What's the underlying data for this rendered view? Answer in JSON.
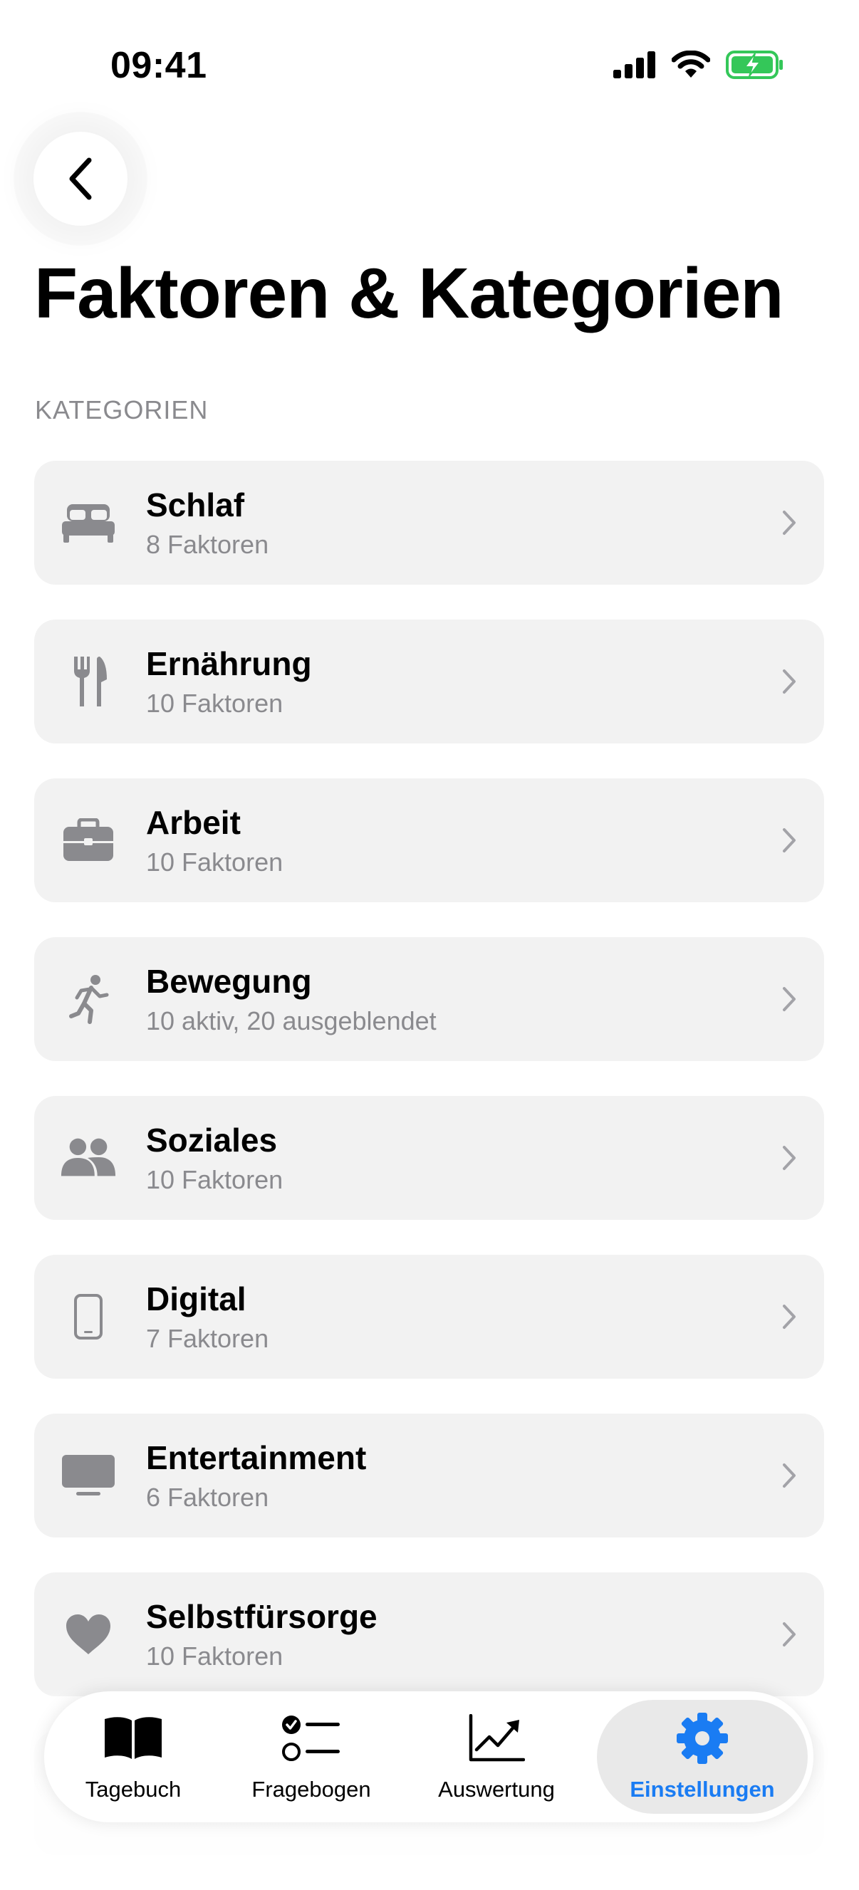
{
  "status_bar": {
    "time": "09:41"
  },
  "page": {
    "title": "Faktoren & Kategorien",
    "section_header": "KATEGORIEN"
  },
  "categories": [
    {
      "title": "Schlaf",
      "subtitle": "8 Faktoren",
      "icon": "bed-icon"
    },
    {
      "title": "Ernährung",
      "subtitle": "10 Faktoren",
      "icon": "fork-knife-icon"
    },
    {
      "title": "Arbeit",
      "subtitle": "10 Faktoren",
      "icon": "briefcase-icon"
    },
    {
      "title": "Bewegung",
      "subtitle": "10 aktiv, 20 ausgeblendet",
      "icon": "running-figure-icon"
    },
    {
      "title": "Soziales",
      "subtitle": "10 Faktoren",
      "icon": "people-icon"
    },
    {
      "title": "Digital",
      "subtitle": "7 Faktoren",
      "icon": "smartphone-icon"
    },
    {
      "title": "Entertainment",
      "subtitle": "6 Faktoren",
      "icon": "tv-icon"
    },
    {
      "title": "Selbstfürsorge",
      "subtitle": "10 Faktoren",
      "icon": "heart-icon"
    }
  ],
  "tab_bar": {
    "tabs": [
      {
        "label": "Tagebuch",
        "icon": "book-icon"
      },
      {
        "label": "Fragebogen",
        "icon": "checklist-icon"
      },
      {
        "label": "Auswertung",
        "icon": "chart-trend-icon"
      },
      {
        "label": "Einstellungen",
        "icon": "gear-icon"
      }
    ],
    "active_tab": "Einstellungen",
    "accent_color": "#1a7cf3"
  },
  "colors": {
    "row_background": "#f2f2f2",
    "secondary_text": "#8a8a8e",
    "battery_green": "#34c759"
  }
}
